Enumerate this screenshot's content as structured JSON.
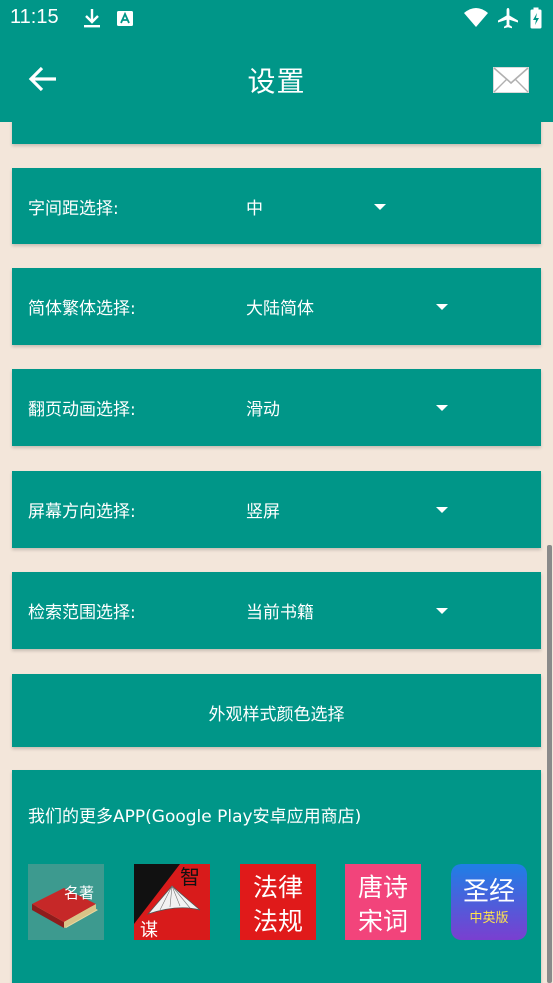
{
  "status_bar": {
    "time": "11:15"
  },
  "app_bar": {
    "title": "设置"
  },
  "settings": [
    {
      "label": "字间距选择:",
      "value": "中"
    },
    {
      "label": "简体繁体选择:",
      "value": "大陆简体"
    },
    {
      "label": "翻页动画选择:",
      "value": "滑动"
    },
    {
      "label": "屏幕方向选择:",
      "value": "竖屏"
    },
    {
      "label": "检索范围选择:",
      "value": "当前书籍"
    }
  ],
  "style_button": {
    "label": "外观样式颜色选择"
  },
  "more_apps": {
    "title": "我们的更多APP(Google Play安卓应用商店)",
    "apps": [
      {
        "icon": "classics-book-icon",
        "text": "名著"
      },
      {
        "icon": "wisdom-fan-icon",
        "text_top": "智",
        "text_bottom": "谋"
      },
      {
        "icon": "law-icon",
        "line1": "法律",
        "line2": "法规"
      },
      {
        "icon": "tang-poetry-icon",
        "line1": "唐诗",
        "line2": "宋词"
      },
      {
        "icon": "bible-icon",
        "line1": "圣经",
        "line2": "中英版"
      }
    ]
  },
  "colors": {
    "primary": "#009688",
    "background": "#F3E6DA"
  }
}
